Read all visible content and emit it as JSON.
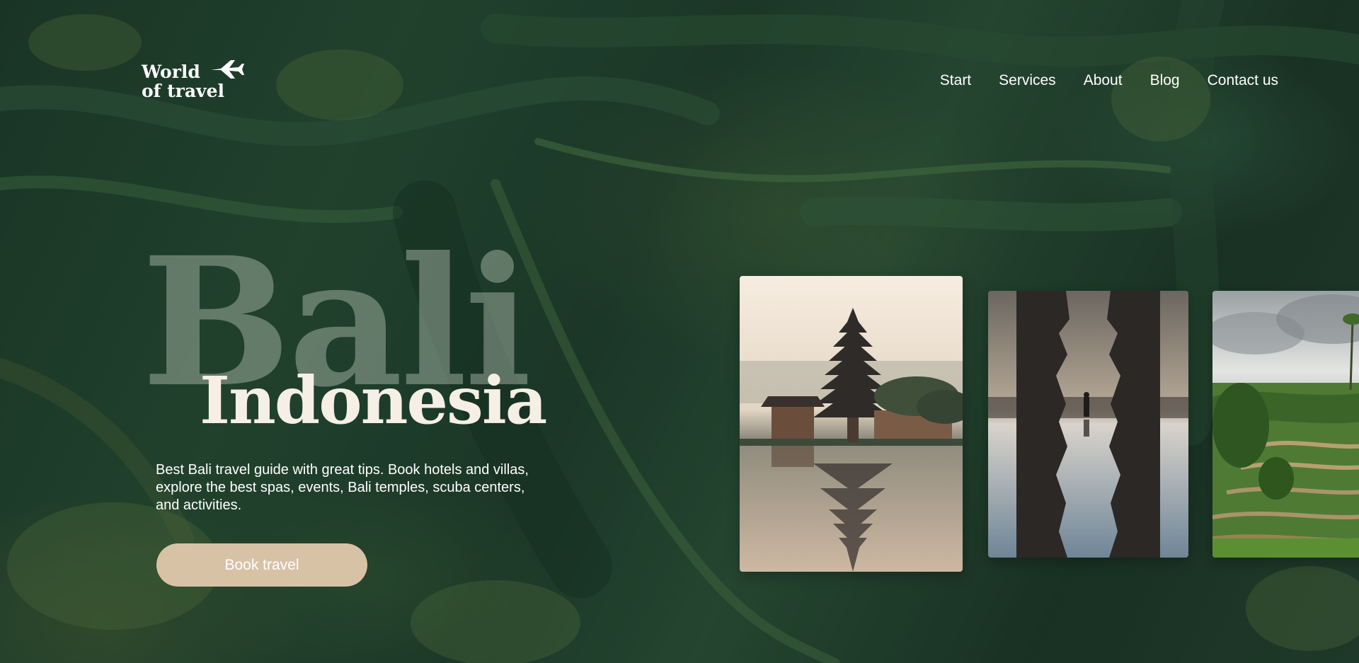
{
  "brand": {
    "line1": "World",
    "line2": "of travel"
  },
  "nav": {
    "items": [
      "Start",
      "Services",
      "About",
      "Blog",
      "Contact us"
    ]
  },
  "hero": {
    "title": "Bali",
    "subtitle": "Indonesia",
    "description": "Best Bali travel guide with great tips. Book hotels and villas, explore the best spas, events, Bali temples, scuba centers, and activities.",
    "cta_label": "Book travel"
  },
  "gallery": {
    "cards": [
      {
        "subject": "lake-temple-pagoda"
      },
      {
        "subject": "temple-gate-reflection"
      },
      {
        "subject": "rice-terraces"
      }
    ]
  },
  "colors": {
    "cta": "#d8c2a6",
    "subtitle": "#f6efe6",
    "background": "#1f3a2c"
  }
}
